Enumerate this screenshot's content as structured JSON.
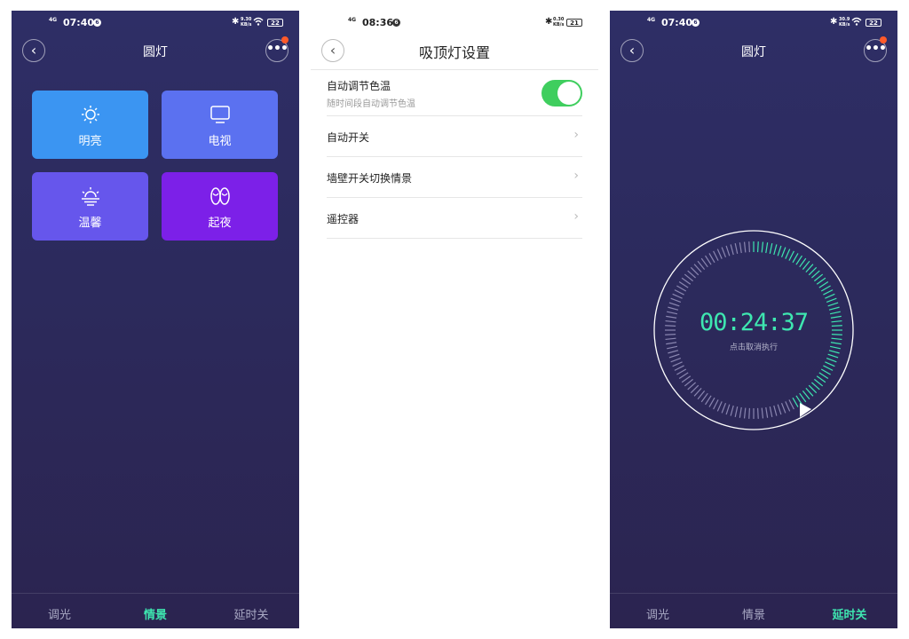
{
  "status_bar": {
    "left_phone": {
      "network": "4G",
      "time": "07:40",
      "notif": "6",
      "speed_top": "9.30",
      "speed_bottom": "KB/s",
      "battery": "22"
    },
    "middle_phone": {
      "network": "4G",
      "time": "08:36",
      "notif": "6",
      "speed_top": "0.30",
      "speed_bottom": "KB/s",
      "battery": "21"
    },
    "right_phone": {
      "network": "4G",
      "time": "07:40",
      "notif": "6",
      "speed_top": "30.9",
      "speed_bottom": "KB/s",
      "battery": "22"
    }
  },
  "scene_screen": {
    "title": "圆灯",
    "scenes": [
      {
        "label": "明亮",
        "icon": "sun-icon"
      },
      {
        "label": "电视",
        "icon": "tv-icon"
      },
      {
        "label": "温馨",
        "icon": "sunset-icon"
      },
      {
        "label": "起夜",
        "icon": "slippers-icon"
      }
    ],
    "tabs": [
      "调光",
      "情景",
      "延时关"
    ],
    "active_tab": "情景"
  },
  "settings_screen": {
    "title": "吸顶灯设置",
    "items": [
      {
        "label": "自动调节色温",
        "sublabel": "随时间段自动调节色温",
        "control": "toggle",
        "on": true
      },
      {
        "label": "自动开关",
        "control": "chevron"
      },
      {
        "label": "墙壁开关切换情景",
        "control": "chevron"
      },
      {
        "label": "遥控器",
        "control": "chevron"
      }
    ]
  },
  "timer_screen": {
    "title": "圆灯",
    "countdown": "00:24:37",
    "hint": "点击取消执行",
    "tabs": [
      "调光",
      "情景",
      "延时关"
    ],
    "active_tab": "延时关"
  },
  "colors": {
    "dark_bg": "#2e2e66",
    "accent_green": "#3ee6b0",
    "toggle_on": "#3fce5e",
    "badge": "#ff5a2a",
    "tile_bright": "#3b95f2",
    "tile_tv": "#5b71f0",
    "tile_warm": "#6656ec",
    "tile_night": "#7c20e8"
  }
}
